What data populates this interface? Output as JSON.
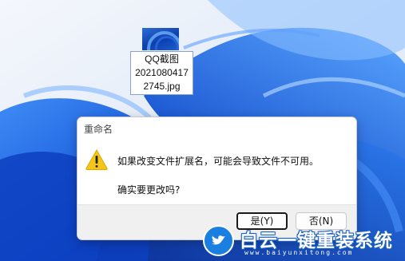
{
  "desktop": {
    "file_icon": {
      "name_line1": "QQ截图",
      "name_line2": "2021080417",
      "name_line3": "2745.jpg"
    }
  },
  "dialog": {
    "title": "重命名",
    "icon": "warning-icon",
    "message": "如果改变文件扩展名，可能会导致文件不可用。",
    "question": "确实要更改吗?",
    "yes_label": "是(Y)",
    "no_label": "否(N)"
  },
  "watermark": {
    "title": "白云一键重装系统",
    "url": "www.baiyunxitong.com"
  },
  "colors": {
    "wallpaper_accent": "#1565e8",
    "warning_yellow": "#f5c518",
    "watermark_blue": "#1a7fe0"
  }
}
